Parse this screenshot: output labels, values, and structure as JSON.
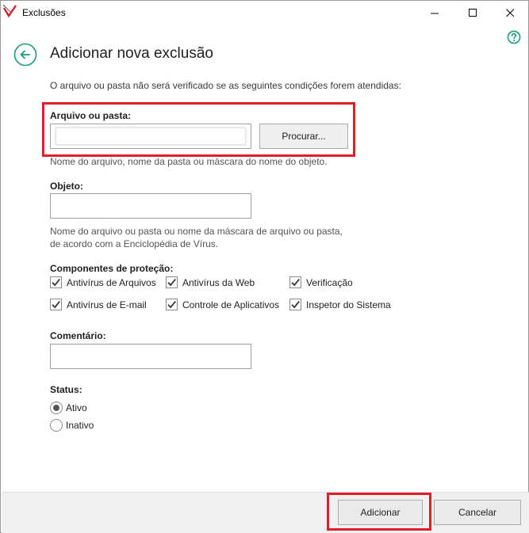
{
  "window": {
    "title": "Exclusões"
  },
  "header": {
    "title": "Adicionar nova exclusão"
  },
  "intro": "O arquivo ou pasta não será verificado se as seguintes condições forem atendidas:",
  "file_or_folder": {
    "label": "Arquivo ou pasta:",
    "value": "",
    "browse_label": "Procurar...",
    "hint": "Nome do arquivo, nome da pasta ou máscara do nome do objeto."
  },
  "object": {
    "label": "Objeto:",
    "value": "",
    "hint_line1": "Nome do arquivo ou pasta ou nome da máscara de arquivo ou pasta,",
    "hint_line2": "de acordo com a Enciclopédia de Vírus."
  },
  "protection": {
    "label": "Componentes de proteção:",
    "items": [
      {
        "label": "Antivírus de Arquivos",
        "checked": true
      },
      {
        "label": "Antivírus da Web",
        "checked": true
      },
      {
        "label": "Verificação",
        "checked": true
      },
      {
        "label": "Antivírus de E-mail",
        "checked": true
      },
      {
        "label": "Controle de Aplicativos",
        "checked": true
      },
      {
        "label": "Inspetor do Sistema",
        "checked": true
      }
    ]
  },
  "comment": {
    "label": "Comentário:",
    "value": ""
  },
  "status": {
    "label": "Status:",
    "options": [
      {
        "label": "Ativo",
        "selected": true
      },
      {
        "label": "Inativo",
        "selected": false
      }
    ]
  },
  "footer": {
    "add_label": "Adicionar",
    "cancel_label": "Cancelar"
  },
  "colors": {
    "accent": "#1a9c7a",
    "highlight": "#e01e2a"
  }
}
